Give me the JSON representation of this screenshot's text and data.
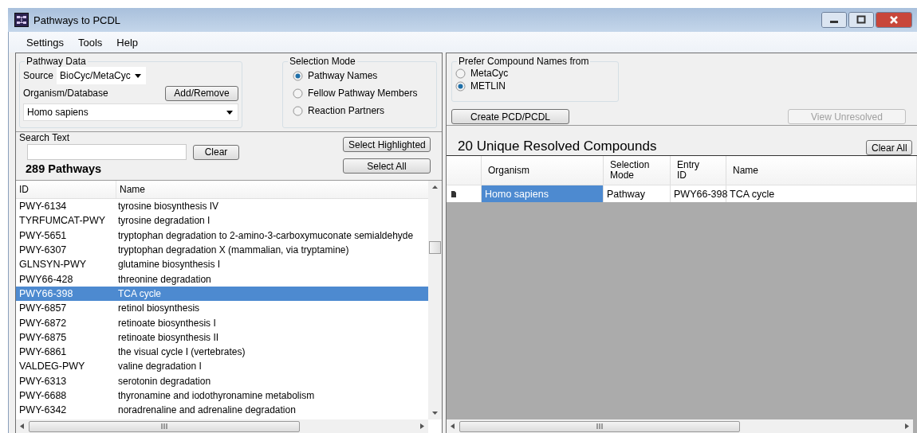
{
  "window": {
    "title": "Pathways to PCDL"
  },
  "menu": [
    {
      "label": "Settings"
    },
    {
      "label": "Tools"
    },
    {
      "label": "Help"
    }
  ],
  "pathway_data": {
    "title": "Pathway Data",
    "source_label": "Source",
    "source_value": "BioCyc/MetaCyc",
    "organism_label": "Organism/Database",
    "add_remove_button": "Add/Remove",
    "organism_value": "Homo sapiens"
  },
  "selection_mode": {
    "title": "Selection Mode",
    "options": [
      {
        "label": "Pathway Names",
        "selected": true
      },
      {
        "label": "Fellow Pathway Members",
        "selected": false
      },
      {
        "label": "Reaction Partners",
        "selected": false
      }
    ]
  },
  "search": {
    "label": "Search Text",
    "clear_button": "Clear"
  },
  "select_highlighted_button": "Select Highlighted",
  "select_all_button": "Select All",
  "pathway_count": "289 Pathways",
  "pathway_table": {
    "columns": [
      "ID",
      "Name"
    ],
    "rows": [
      {
        "id": "PWY-6134",
        "name": "tyrosine biosynthesis IV",
        "selected": false
      },
      {
        "id": "TYRFUMCAT-PWY",
        "name": "tyrosine degradation I",
        "selected": false
      },
      {
        "id": "PWY-5651",
        "name": "tryptophan degradation to 2-amino-3-carboxymuconate semialdehyde",
        "selected": false
      },
      {
        "id": "PWY-6307",
        "name": "tryptophan degradation X (mammalian, via tryptamine)",
        "selected": false
      },
      {
        "id": "GLNSYN-PWY",
        "name": "glutamine biosynthesis I",
        "selected": false
      },
      {
        "id": "PWY66-428",
        "name": "threonine degradation",
        "selected": false
      },
      {
        "id": "PWY66-398",
        "name": "TCA cycle",
        "selected": true
      },
      {
        "id": "PWY-6857",
        "name": "retinol biosynthesis",
        "selected": false
      },
      {
        "id": "PWY-6872",
        "name": "retinoate biosynthesis I",
        "selected": false
      },
      {
        "id": "PWY-6875",
        "name": "retinoate biosynthesis II",
        "selected": false
      },
      {
        "id": "PWY-6861",
        "name": "the visual cycle I (vertebrates)",
        "selected": false
      },
      {
        "id": "VALDEG-PWY",
        "name": "valine degradation I",
        "selected": false
      },
      {
        "id": "PWY-6313",
        "name": "serotonin degradation",
        "selected": false
      },
      {
        "id": "PWY-6688",
        "name": "thyronamine and iodothyronamine metabolism",
        "selected": false
      },
      {
        "id": "PWY-6342",
        "name": "noradrenaline and adrenaline degradation",
        "selected": false
      }
    ]
  },
  "compound_names": {
    "title": "Prefer Compound Names from",
    "options": [
      {
        "label": "MetaCyc",
        "selected": false
      },
      {
        "label": "METLIN",
        "selected": true
      }
    ]
  },
  "create_button": "Create PCD/PCDL",
  "view_unresolved_button": {
    "label": "View Unresolved",
    "disabled": true
  },
  "resolved_title": "20 Unique Resolved Compounds",
  "clear_all_button": "Clear All",
  "results_table": {
    "columns": [
      "Organism",
      "Selection\nMode",
      "Entry\nID",
      "Name"
    ],
    "rows": [
      {
        "cells": [
          "Homo sapiens",
          "Pathway",
          "PWY66-398",
          "TCA cycle"
        ],
        "selected": true
      }
    ]
  }
}
